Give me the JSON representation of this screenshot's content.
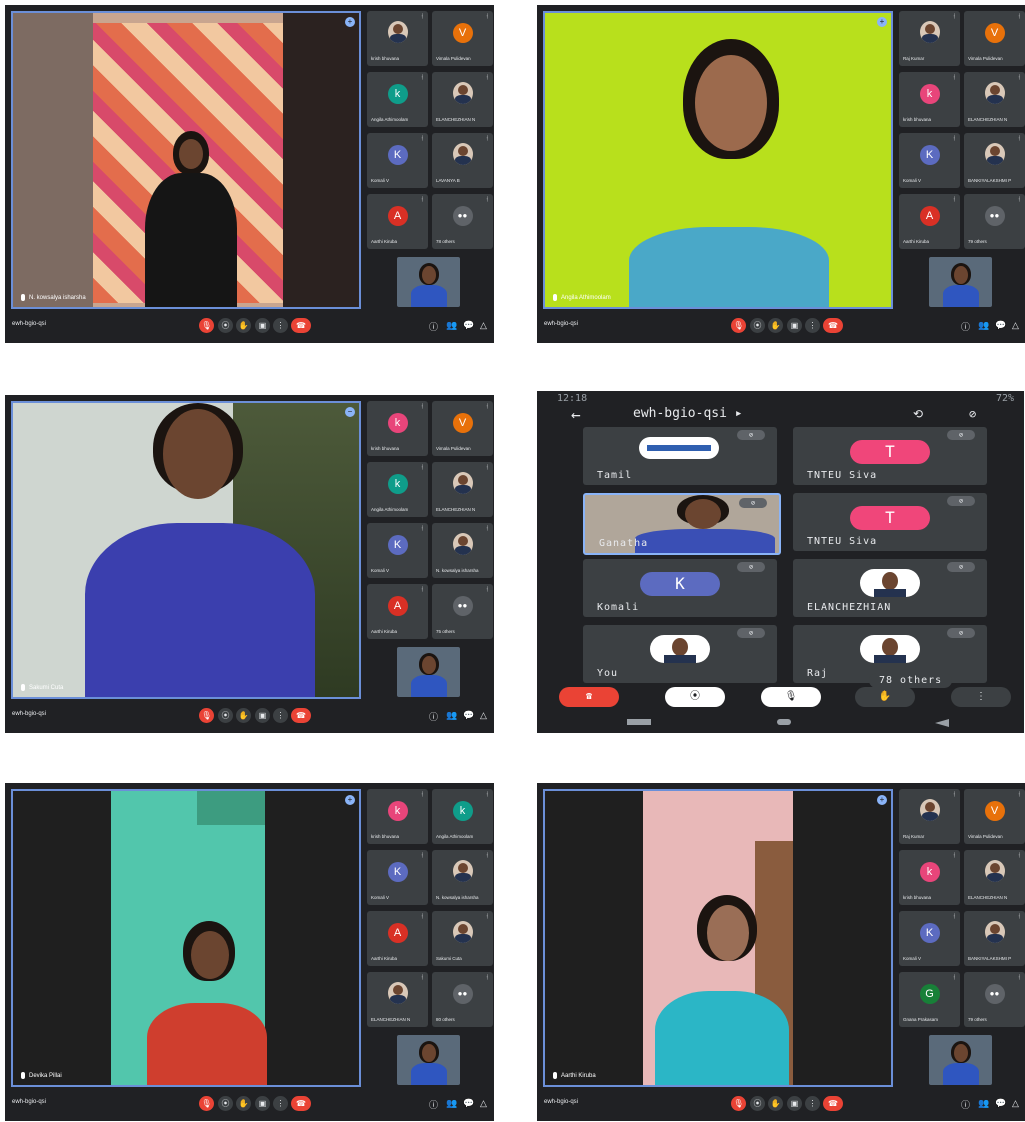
{
  "colors": {
    "accent": "#8ab4f8",
    "end_call": "#ea4335",
    "pink_avatar": "#e8457a",
    "teal_avatar": "#0f9d8a",
    "orange_avatar": "#e8710a",
    "purple_avatar": "#5c6bc0",
    "red_avatar": "#d93025",
    "green_avatar": "#188038",
    "border": "#6b8fd8"
  },
  "controls": {
    "mic": "🎙",
    "cam": "⦿",
    "hand": "✋",
    "present": "▣",
    "more": "⋮",
    "end": "☎",
    "info": "ⓘ",
    "people": "👥",
    "chat": "💬",
    "activities": "△"
  },
  "screens": [
    {
      "meeting_code": "ewh-bgio-qsi",
      "speaker_name": "N. kowsalya isharsha",
      "tiles": [
        {
          "name": "krish bhuvana",
          "letter": "",
          "kind": "photo"
        },
        {
          "name": "Vimala Pulidevan",
          "letter": "V",
          "kind": "orange"
        },
        {
          "name": "Angila Athimoolam",
          "letter": "k",
          "kind": "teal"
        },
        {
          "name": "ELANCHEZHIAN N",
          "letter": "",
          "kind": "photo"
        },
        {
          "name": "Komali V",
          "letter": "K",
          "kind": "purple"
        },
        {
          "name": "LAVANYA B",
          "letter": "",
          "kind": "photo"
        },
        {
          "name": "Aarthi Kiruba",
          "letter": "A",
          "kind": "red"
        },
        {
          "name": "78 others",
          "letter": "",
          "kind": "group"
        }
      ]
    },
    {
      "meeting_code": "ewh-bgio-qsi",
      "speaker_name": "Angila Athimoolam",
      "tiles": [
        {
          "name": "Raj Kumar",
          "letter": "",
          "kind": "photo"
        },
        {
          "name": "Vimala Pulidevan",
          "letter": "V",
          "kind": "orange"
        },
        {
          "name": "krish bhuvana",
          "letter": "k",
          "kind": "pink"
        },
        {
          "name": "ELANCHEZHIAN N",
          "letter": "",
          "kind": "photo"
        },
        {
          "name": "Komali V",
          "letter": "K",
          "kind": "purple"
        },
        {
          "name": "BANKIYALAKSHMI P",
          "letter": "",
          "kind": "photo"
        },
        {
          "name": "Aarthi Kiruba",
          "letter": "A",
          "kind": "red"
        },
        {
          "name": "79 others",
          "letter": "",
          "kind": "group"
        }
      ]
    },
    {
      "meeting_code": "ewh-bgio-qsi",
      "speaker_name": "Sakumi Cuta",
      "tiles": [
        {
          "name": "krish bhuvana",
          "letter": "k",
          "kind": "pink"
        },
        {
          "name": "Vimala Pulidevan",
          "letter": "V",
          "kind": "orange"
        },
        {
          "name": "Angila Athimoolam",
          "letter": "k",
          "kind": "teal"
        },
        {
          "name": "ELANCHEZHIAN N",
          "letter": "",
          "kind": "photo"
        },
        {
          "name": "Komali V",
          "letter": "K",
          "kind": "purple"
        },
        {
          "name": "N. kowsalya isharsha",
          "letter": "",
          "kind": "photo"
        },
        {
          "name": "Aarthi Kiruba",
          "letter": "A",
          "kind": "red"
        },
        {
          "name": "75 others",
          "letter": "",
          "kind": "group"
        }
      ]
    },
    {
      "meeting_code": "ewh-bgio-qsi",
      "speaker_name": "Devika Pillai",
      "tiles": [
        {
          "name": "krish bhuvana",
          "letter": "k",
          "kind": "pink"
        },
        {
          "name": "Angila Athimoolam",
          "letter": "k",
          "kind": "teal"
        },
        {
          "name": "Komali V",
          "letter": "K",
          "kind": "purple"
        },
        {
          "name": "N. kowsalya isharsha",
          "letter": "",
          "kind": "photo"
        },
        {
          "name": "Aarthi Kiruba",
          "letter": "A",
          "kind": "red"
        },
        {
          "name": "Sakumi Cuta",
          "letter": "",
          "kind": "photo"
        },
        {
          "name": "ELANCHEZHIAN N",
          "letter": "",
          "kind": "photo"
        },
        {
          "name": "80 others",
          "letter": "",
          "kind": "group"
        }
      ]
    },
    {
      "meeting_code": "ewh-bgio-qsi",
      "speaker_name": "Aarthi Kiruba",
      "tiles": [
        {
          "name": "Raj Kumar",
          "letter": "",
          "kind": "photo"
        },
        {
          "name": "Vimala Pulidevan",
          "letter": "V",
          "kind": "orange"
        },
        {
          "name": "krish bhuvana",
          "letter": "k",
          "kind": "pink"
        },
        {
          "name": "ELANCHEZHIAN N",
          "letter": "",
          "kind": "photo"
        },
        {
          "name": "Komali V",
          "letter": "K",
          "kind": "purple"
        },
        {
          "name": "BANKIYALAKSHMI P",
          "letter": "",
          "kind": "photo"
        },
        {
          "name": "Gnana Prakasam",
          "letter": "G",
          "kind": "green"
        },
        {
          "name": "79 others",
          "letter": "",
          "kind": "group"
        }
      ]
    }
  ],
  "phone": {
    "time": "12:18",
    "battery": "72%",
    "title": "ewh-bgio-qsi ▸",
    "tiles": [
      {
        "name": "Tamil",
        "letter": "",
        "kind": "logo"
      },
      {
        "name": "TNTEU Siva",
        "letter": "T",
        "kind": "pink"
      },
      {
        "name": "Ganatha",
        "letter": "",
        "kind": "video"
      },
      {
        "name": "TNTEU Siva",
        "letter": "T",
        "kind": "pink"
      },
      {
        "name": "Komali",
        "letter": "K",
        "kind": "purple"
      },
      {
        "name": "ELANCHEZHIAN",
        "letter": "",
        "kind": "photo"
      },
      {
        "name": "You",
        "letter": "",
        "kind": "photo"
      },
      {
        "name": "Raj",
        "letter": "",
        "kind": "photo"
      }
    ],
    "others": "78 others"
  }
}
